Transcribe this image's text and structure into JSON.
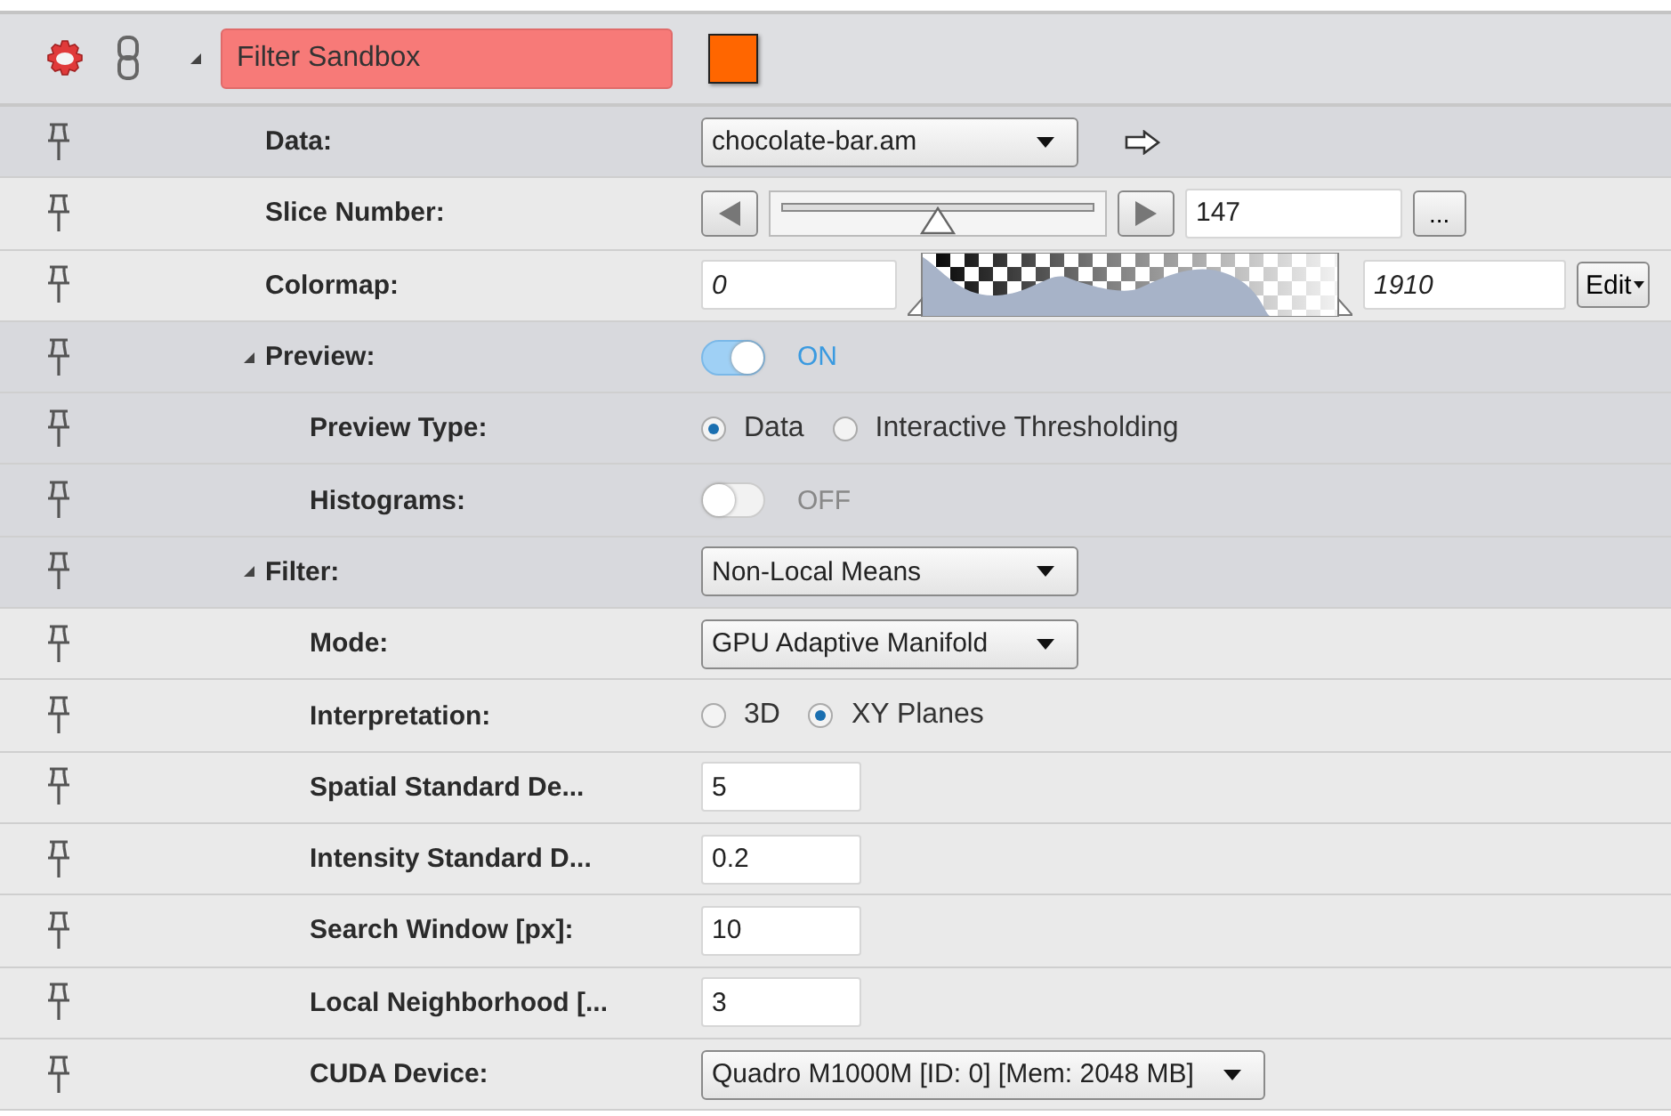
{
  "header": {
    "title": "Filter Sandbox",
    "color": "#ff6600",
    "expanded": true
  },
  "rows": [
    {
      "label": "Data:",
      "highlighted": true,
      "kind": "dropdown",
      "value": "chocolate-bar.am",
      "link_arrow": true
    },
    {
      "label": "Slice Number:",
      "highlighted": false,
      "kind": "slider",
      "level": 0.5,
      "value": "147",
      "button": "..."
    },
    {
      "label": "Colormap:",
      "highlighted": false,
      "kind": "colormap",
      "min": "0",
      "max": "1910",
      "button": "Edit"
    },
    {
      "label": "Preview:",
      "highlighted": true,
      "expanded": true,
      "kind": "toggle",
      "on": true,
      "state_label": "ON",
      "children": [
        {
          "label": "Preview Type:",
          "highlighted": true,
          "kind": "radio",
          "options": [
            {
              "label": "Data",
              "selected": true
            },
            {
              "label": "Interactive Thresholding",
              "selected": false
            }
          ]
        },
        {
          "label": "Histograms:",
          "highlighted": true,
          "kind": "toggle",
          "on": false,
          "state_label": "OFF"
        }
      ]
    },
    {
      "label": "Filter:",
      "highlighted": true,
      "expanded": true,
      "kind": "dropdown",
      "value": "Non-Local Means",
      "children": [
        {
          "label": "Mode:",
          "highlighted": false,
          "kind": "dropdown",
          "value": "GPU Adaptive Manifold"
        },
        {
          "label": "Interpretation:",
          "highlighted": false,
          "kind": "radio",
          "options": [
            {
              "label": "3D",
              "selected": false
            },
            {
              "label": "XY Planes",
              "selected": true
            }
          ]
        },
        {
          "label": "Spatial Standard De...",
          "highlighted": false,
          "kind": "input",
          "value": "5"
        },
        {
          "label": "Intensity Standard D...",
          "highlighted": false,
          "kind": "input",
          "value": "0.2"
        },
        {
          "label": "Search Window [px]:",
          "highlighted": false,
          "kind": "input",
          "value": "10"
        },
        {
          "label": "Local Neighborhood [...",
          "highlighted": false,
          "kind": "input",
          "value": "3"
        },
        {
          "label": "CUDA Device:",
          "highlighted": false,
          "kind": "dropdown",
          "value": "Quadro M1000M [ID: 0] [Mem: 2048 MB]"
        }
      ]
    }
  ]
}
